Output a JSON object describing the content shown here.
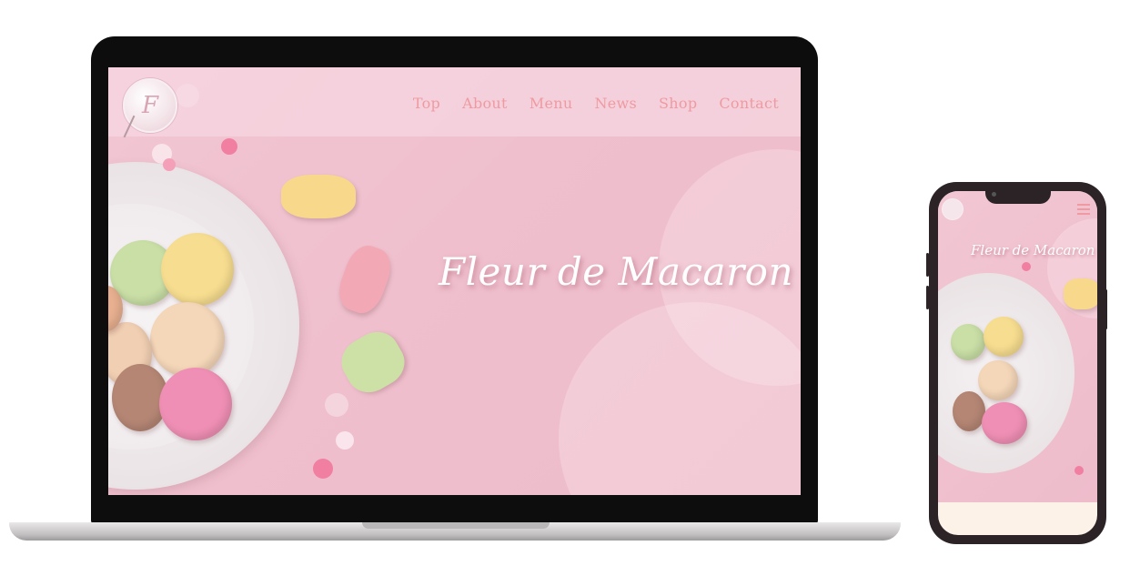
{
  "site": {
    "brand_initial": "F",
    "title": "Fleur de Macaron"
  },
  "nav": {
    "items": [
      "Top",
      "About",
      "Menu",
      "News",
      "Shop",
      "Contact"
    ]
  },
  "icons": {
    "logo": "floral-f-monogram-logo",
    "mobile_menu": "hamburger-menu-icon"
  },
  "colors": {
    "accent": "#ef9aa0",
    "hero_pink": "#efbfcd",
    "footer_cream": "#fcf2e7"
  }
}
